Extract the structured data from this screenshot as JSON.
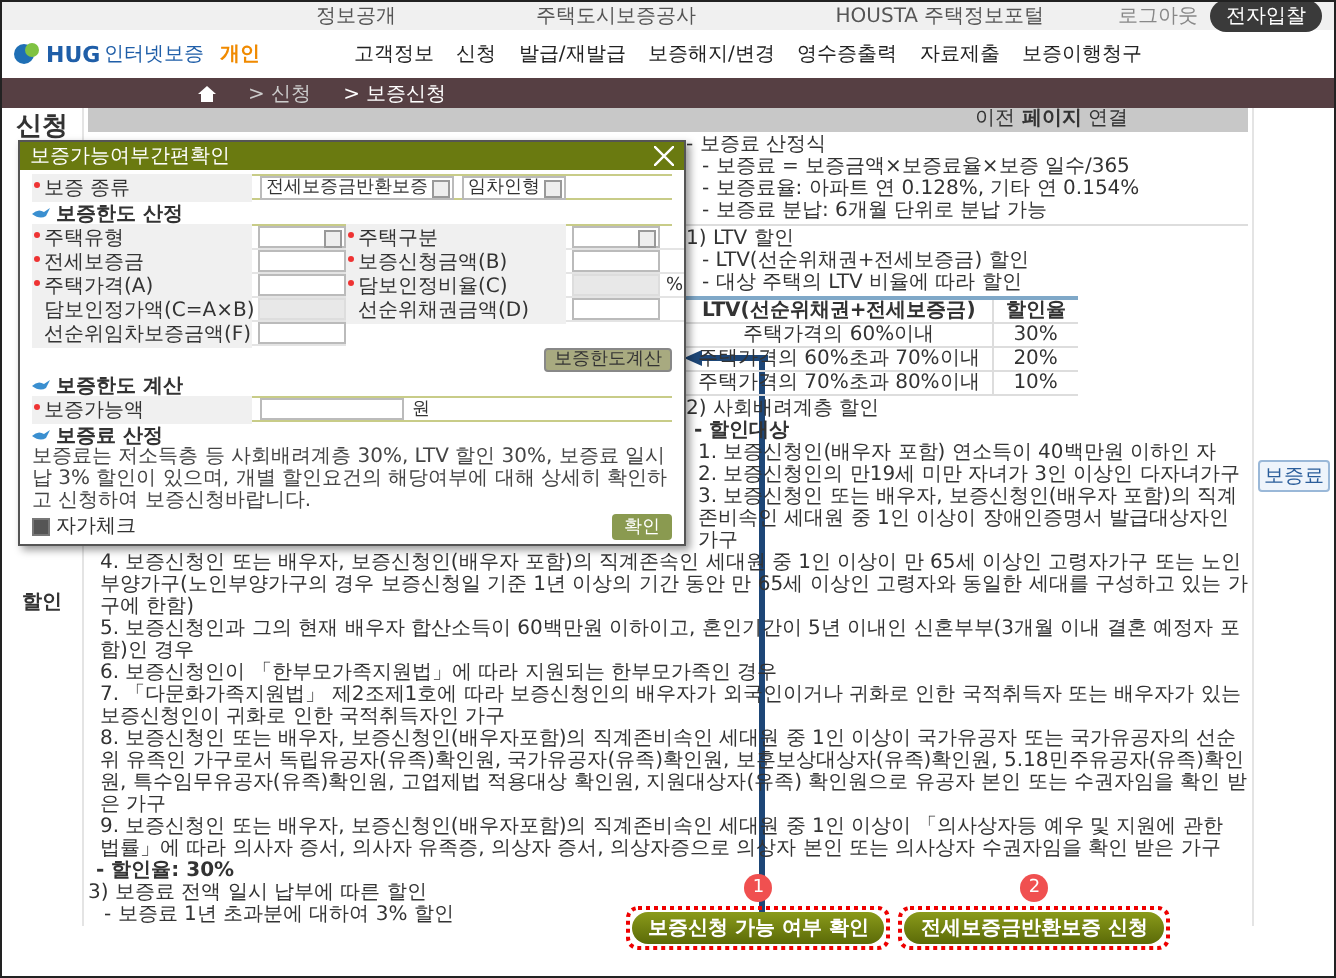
{
  "top_links": [
    "정보공개",
    "주택도시보증공사",
    "HOUSTA 주택정보포털"
  ],
  "logout": "로그아웃",
  "top_button": "전자입찰",
  "logo": {
    "name": "HUG",
    "sub": "인터넷보증",
    "tag": "개인"
  },
  "nav": [
    "고객정보",
    "신청",
    "발급/재발급",
    "보증해지/변경",
    "영수증출력",
    "자료제출",
    "보증이행청구"
  ],
  "breadcrumb": [
    "> 신청",
    "> 보증신청"
  ],
  "side": {
    "title": "신청",
    "label": "할인"
  },
  "banner": "이전 **페이지** 연결",
  "action": "보증료",
  "blocks": [
    {
      "kind": "head",
      "text": "- 보증료 산정식"
    },
    {
      "kind": "sub",
      "text": "- 보증료 = 보증금액×보증료율×보증 일수/365"
    },
    {
      "kind": "sub",
      "text": "- 보증료율: 아파트 연 0.128%, 기타 연 0.154%"
    },
    {
      "kind": "sub",
      "text": "- 보증료 분납: 6개월 단위로 분납 가능"
    },
    {
      "kind": "rule"
    },
    {
      "kind": "head",
      "text": "1) LTV 할인"
    },
    {
      "kind": "sub",
      "text": "- LTV(선순위채권+전세보증금) 할인"
    },
    {
      "kind": "sub",
      "text": "- 대상 주택의 LTV 비율에 따라 할인"
    },
    {
      "kind": "table",
      "columns": [
        "LTV(선순위채권+전세보증금)",
        "할인율"
      ],
      "rows": [
        [
          "주택가격의 60%이내",
          "30%"
        ],
        [
          "주택가격의 60%초과 70%이내",
          "20%"
        ],
        [
          "주택가격의 70%초과 80%이내",
          "10%"
        ]
      ]
    },
    {
      "kind": "head",
      "text": "2) 사회배려계층 할인"
    },
    {
      "kind": "bold",
      "text": "- 할인대상"
    },
    {
      "kind": "item",
      "text": "1. 보증신청인(배우자 포함) 연소득이 40백만원 이하인 자"
    },
    {
      "kind": "item",
      "text": "2. 보증신청인의 만19세 미만 자녀가 3인 이상인 다자녀가구"
    },
    {
      "kind": "item",
      "text": "3. 보증신청인 또는 배우자, 보증신청인(배우자 포함)의 직계존비속인 세대원 중 1인 이상이 장애인증명서 발급대상자인 가구"
    },
    {
      "kind": "item",
      "text": "4. 보증신청인 또는 배우자, 보증신청인(배우자 포함)의 직계존속인 세대원 중 1인 이상이 만 65세 이상인 고령자가구 또는 노인부양가구(노인부양가구의 경우 보증신청일 기준 1년 이상의 기간 동안 만 65세 이상인 고령자와 동일한 세대를 구성하고 있는 가구에 한함)"
    },
    {
      "kind": "item",
      "text": "5. 보증신청인과 그의 현재 배우자 합산소득이 60백만원 이하이고, 혼인기간이 5년 이내인 신혼부부(3개월 이내 결혼 예정자 포함)인 경우"
    },
    {
      "kind": "item",
      "text": "6. 보증신청인이 「한부모가족지원법」에 따라 지원되는 한부모가족인 경우"
    },
    {
      "kind": "item",
      "text": "7. 「다문화가족지원법」 제2조제1호에 따라 보증신청인의 배우자가 외국인이거나 귀화로 인한 국적취득자 또는 배우자가 있는 보증신청인이 귀화로 인한 국적취득자인 가구"
    },
    {
      "kind": "item",
      "text": "8. 보증신청인 또는 배우자, 보증신청인(배우자포함)의 직계존비속인 세대원 중 1인 이상이 국가유공자 또는 국가유공자의 선순위 유족인 가구로서 독립유공자(유족)확인원, 국가유공자(유족)확인원, 보훈보상대상자(유족)확인원, 5.18민주유공자(유족)확인원, 특수임무유공자(유족)확인원, 고엽제법 적용대상 확인원, 지원대상자(유족) 확인원으로 유공자 본인 또는 수권자임을 확인 받은 가구"
    },
    {
      "kind": "item",
      "text": "9. 보증신청인 또는 배우자, 보증신청인(배우자포함)의 직계존비속인 세대원 중 1인 이상이 「의사상자등 예우 및 지원에 관한 법률」에 따라 의사자 증서, 의사자 유족증, 의상자 증서, 의상자증으로 의상자 본인 또는 의사상자 수권자임을 확인 받은 가구"
    },
    {
      "kind": "bold",
      "text": "- 할인율: 30%"
    },
    {
      "kind": "head",
      "text": "3) 보증료 전액 일시 납부에 따른 할인"
    },
    {
      "kind": "sub",
      "text": "- 보증료 1년 초과분에 대하여 3% 할인"
    }
  ],
  "popup": {
    "title": "보증가능여부간편확인",
    "type": {
      "label": "보증 종류",
      "selects": [
        "전세보증금반환보증",
        "임차인형"
      ]
    },
    "limit": {
      "title": "보증한도 산정",
      "button": "보증한도계산",
      "fields": [
        {
          "label": "주택유형",
          "kind": "select",
          "required": true
        },
        {
          "label": "주택구분",
          "kind": "select",
          "required": true
        },
        {
          "label": "전세보증금",
          "kind": "input",
          "required": true
        },
        {
          "label": "보증신청금액(B)",
          "kind": "input",
          "required": true
        },
        {
          "label": "주택가격(A)",
          "kind": "input",
          "required": true
        },
        {
          "label": "담보인정비율(C)",
          "kind": "readonly",
          "required": true,
          "unit": "%"
        },
        {
          "label": "담보인정가액(C=A×B)",
          "kind": "readonly",
          "required": false
        },
        {
          "label": "선순위채권금액(D)",
          "kind": "input",
          "required": false
        },
        {
          "label": "선순위임차보증금액(F)",
          "kind": "input",
          "required": false
        }
      ]
    },
    "result": {
      "title": "보증한도 계산",
      "label": "보증가능액",
      "unit": "원",
      "required": true
    },
    "fee": {
      "title": "보증료 산정",
      "text": "보증료는 저소득층 등 사회배려계층 30%, LTV 할인 30%, 보증료 일시납 3% 할인이 있으며, 개별 할인요건의 해당여부에 대해 상세히 확인하고 신청하여 보증신청바랍니다."
    },
    "check": {
      "label": "자가체크",
      "checked": true
    },
    "confirm": "확인"
  },
  "buttons": [
    {
      "label": "보증신청 가능 여부 확인",
      "badge": "1"
    },
    {
      "label": "전세보증금반환보증 신청",
      "badge": "2"
    }
  ]
}
